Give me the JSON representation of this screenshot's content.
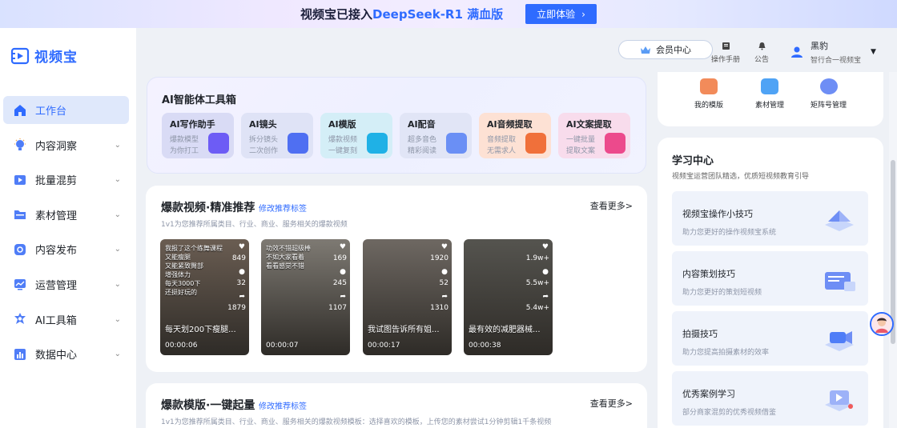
{
  "banner": {
    "text_prefix": "视频宝已接入",
    "text_accent": "DeepSeek-R1 满血版",
    "cta": "立即体验"
  },
  "app": {
    "name": "视频宝"
  },
  "nav": {
    "items": [
      {
        "label": "工作台",
        "icon": "home-icon",
        "active": true
      },
      {
        "label": "内容洞察",
        "icon": "bulb-icon"
      },
      {
        "label": "批量混剪",
        "icon": "film-icon"
      },
      {
        "label": "素材管理",
        "icon": "folder-icon"
      },
      {
        "label": "内容发布",
        "icon": "publish-icon"
      },
      {
        "label": "运营管理",
        "icon": "chart-icon"
      },
      {
        "label": "AI工具箱",
        "icon": "ai-icon"
      },
      {
        "label": "数据中心",
        "icon": "bar-chart-icon"
      }
    ]
  },
  "header": {
    "vip": "会员中心",
    "manual": "操作手册",
    "notice": "公告",
    "user_name": "黑豹",
    "user_sub": "智行合一视频宝"
  },
  "toolbox": {
    "title": "AI智能体工具箱",
    "tools": [
      {
        "name": "AI写作助手",
        "l1": "爆款模型",
        "l2": "为你打工",
        "color": "#d9dbf5",
        "icon": "#6d5cf5"
      },
      {
        "name": "AI镜头",
        "l1": "拆分镜头",
        "l2": "二次创作",
        "color": "#dfe3f6",
        "icon": "#4f6ff2"
      },
      {
        "name": "AI模版",
        "l1": "爆款视频",
        "l2": "一键复刻",
        "color": "#d4eef7",
        "icon": "#1fb1e6"
      },
      {
        "name": "AI配音",
        "l1": "超多音色",
        "l2": "精彩阅读",
        "color": "#e1e5f6",
        "icon": "#6a8ff5"
      },
      {
        "name": "AI音频提取",
        "l1": "音频提取",
        "l2": "无需求人",
        "color": "#fde1d4",
        "icon": "#f0703a"
      },
      {
        "name": "AI文案提取",
        "l1": "一键批量",
        "l2": "提取文案",
        "color": "#f8dcec",
        "icon": "#ec4a8c"
      }
    ]
  },
  "hot": {
    "title": "爆款视频·精准推荐",
    "edit": "修改推荐标签",
    "more": "查看更多>",
    "sub": "1v1为您推荐所属类目、行业、商业、服务相关的爆款视频",
    "videos": [
      {
        "overlay": "我报了这个练舞课程\n又能瘦腿\n又能紧致臀部\n增强体力\n每天3000下\n还挺好玩的",
        "caption": "每天划200下瘦腿...",
        "duration": "00:00:06",
        "likes": "849",
        "comments": "32",
        "shares": "1879",
        "bg": "#6a5d52"
      },
      {
        "overlay": "功效不错超级棒\n不如大家看着\n看看感觉不错",
        "caption": "",
        "duration": "00:00:07",
        "likes": "169",
        "comments": "245",
        "shares": "1107",
        "bg": "#7e7a73"
      },
      {
        "overlay": "",
        "caption": "我试图告诉所有姐...",
        "duration": "00:00:17",
        "likes": "1920",
        "comments": "52",
        "shares": "1310",
        "bg": "#6e6862"
      },
      {
        "overlay": "",
        "caption": "最有效的减肥器械...",
        "duration": "00:00:38",
        "likes": "1.9w+",
        "comments": "5.5w+",
        "shares": "5.4w+",
        "bg": "#55544f"
      }
    ]
  },
  "tmpl": {
    "title": "爆款模版·一键起量",
    "edit": "修改推荐标签",
    "more": "查看更多>",
    "sub": "1v1为您推荐所属类目、行业、商业、服务相关的爆款视频模板：选择喜欢的模板，上传您的素材尝试1分钟剪辑1千条视频"
  },
  "right_top": {
    "items": [
      {
        "label": "我的模版",
        "color": "#f28b5a"
      },
      {
        "label": "素材管理",
        "color": "#4fa3f5"
      },
      {
        "label": "矩阵号管理",
        "color": "#6e8ef5"
      }
    ]
  },
  "learn": {
    "title": "学习中心",
    "sub": "视频宝运营团队精选，优质短视频教育引导",
    "items": [
      {
        "title": "视频宝操作小技巧",
        "desc": "助力您更好的操作视频宝系统"
      },
      {
        "title": "内容策划技巧",
        "desc": "助力您更好的策划短视频"
      },
      {
        "title": "拍摄技巧",
        "desc": "助力您提高拍摄素材的效率"
      },
      {
        "title": "优秀案例学习",
        "desc": "部分商家混剪的优秀视频借鉴"
      }
    ]
  }
}
